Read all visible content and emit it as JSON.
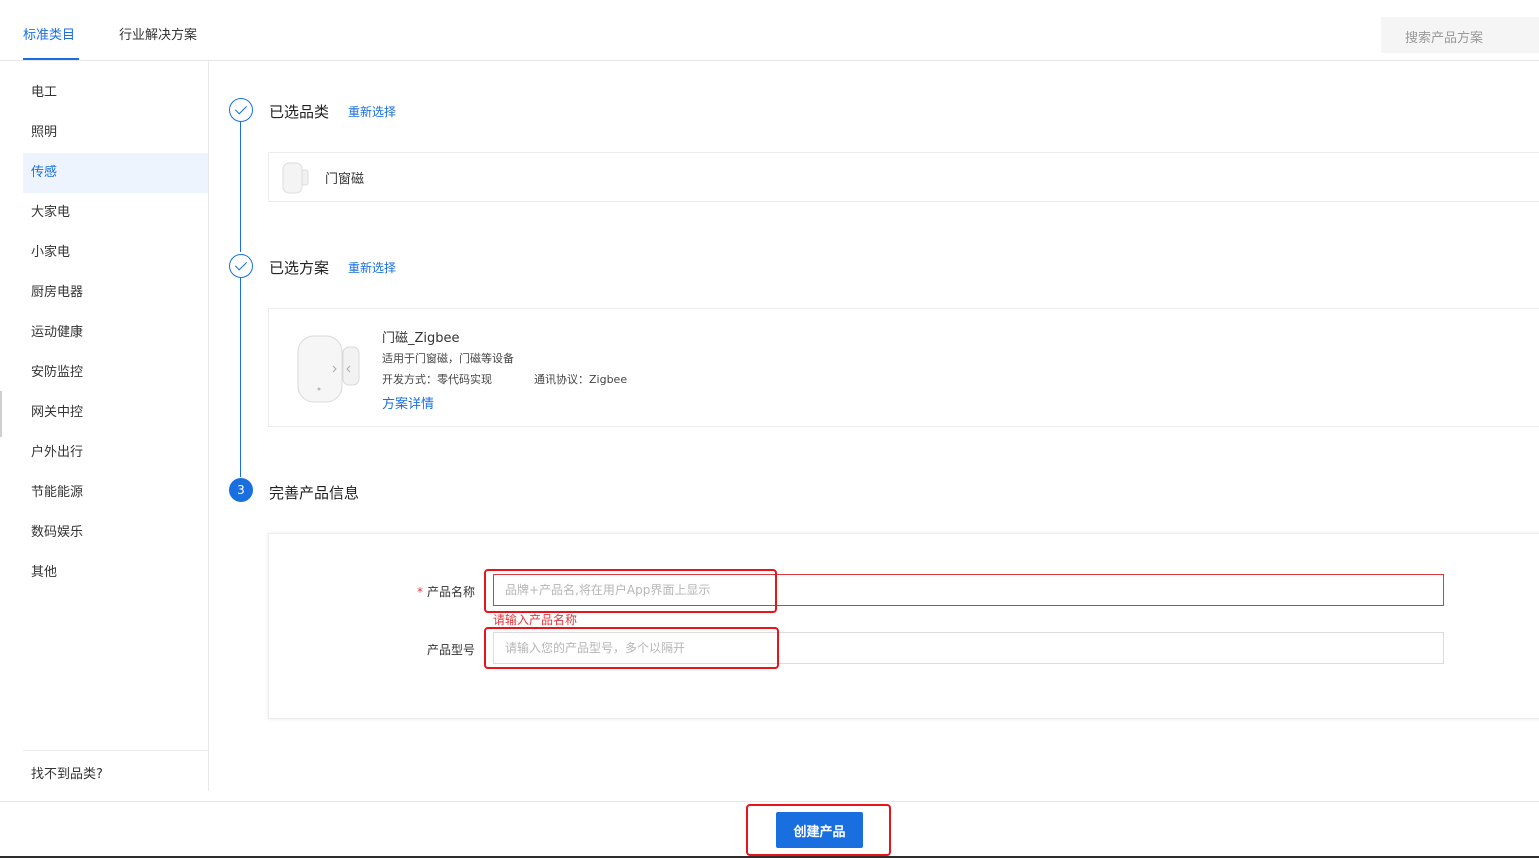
{
  "header": {
    "tabs": [
      {
        "label": "标准类目",
        "active": true
      },
      {
        "label": "行业解决方案",
        "active": false
      }
    ],
    "search_placeholder": "搜索产品方案"
  },
  "sidebar": {
    "items": [
      {
        "label": "电工"
      },
      {
        "label": "照明"
      },
      {
        "label": "传感",
        "active": true
      },
      {
        "label": "大家电"
      },
      {
        "label": "小家电"
      },
      {
        "label": "厨房电器"
      },
      {
        "label": "运动健康"
      },
      {
        "label": "安防监控"
      },
      {
        "label": "网关中控"
      },
      {
        "label": "户外出行"
      },
      {
        "label": "节能能源"
      },
      {
        "label": "数码娱乐"
      },
      {
        "label": "其他"
      }
    ],
    "footer_link": "找不到品类?"
  },
  "steps": {
    "step1": {
      "title": "已选品类",
      "reselect": "重新选择",
      "category": "门窗磁"
    },
    "step2": {
      "title": "已选方案",
      "reselect": "重新选择",
      "solution_name": "门磁_Zigbee",
      "solution_desc": "适用于门窗磁，门磁等设备",
      "dev_method": "开发方式：零代码实现",
      "protocol": "通讯协议：Zigbee",
      "detail_link": "方案详情"
    },
    "step3": {
      "number": "3",
      "title": "完善产品信息"
    }
  },
  "form": {
    "name_label": "产品名称",
    "name_required_mark": "*",
    "name_placeholder": "品牌+产品名,将在用户App界面上显示",
    "name_value": "",
    "name_error": "请输入产品名称",
    "model_label": "产品型号",
    "model_placeholder": "请输入您的产品型号，多个以隔开",
    "model_value": ""
  },
  "footer": {
    "create_button": "创建产品"
  },
  "colors": {
    "accent": "#1a6fe0",
    "error": "#e0383e",
    "highlight": "#e8141a"
  }
}
